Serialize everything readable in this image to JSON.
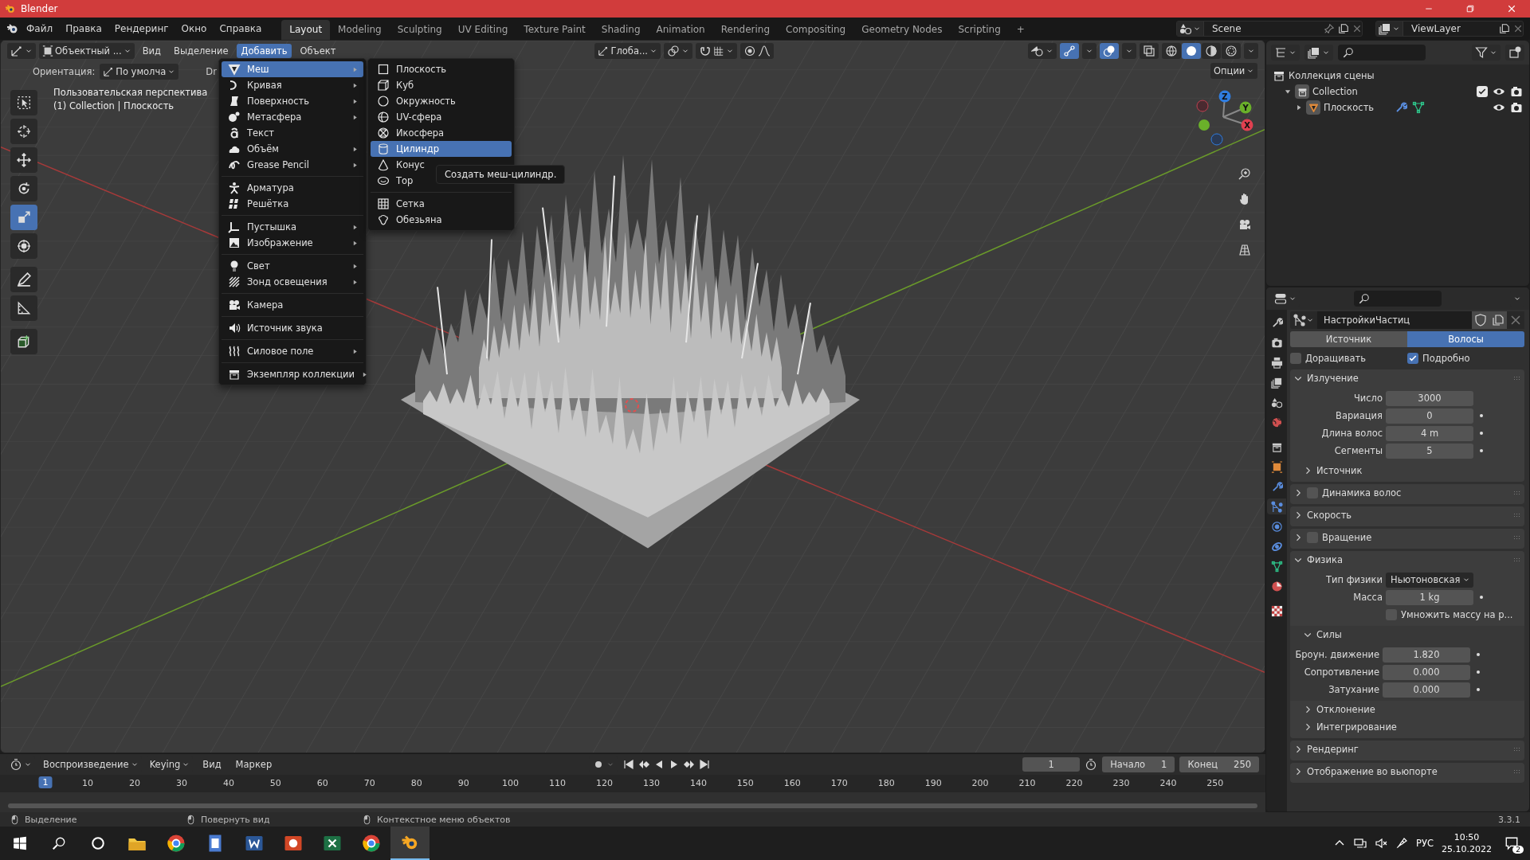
{
  "window": {
    "title": "Blender"
  },
  "menu_bar": [
    "Файл",
    "Правка",
    "Рендеринг",
    "Окно",
    "Справка"
  ],
  "workspace_tabs": [
    {
      "label": "Layout",
      "selected": true
    },
    {
      "label": "Modeling",
      "selected": false
    },
    {
      "label": "Sculpting",
      "selected": false
    },
    {
      "label": "UV Editing",
      "selected": false
    },
    {
      "label": "Texture Paint",
      "selected": false
    },
    {
      "label": "Shading",
      "selected": false
    },
    {
      "label": "Animation",
      "selected": false
    },
    {
      "label": "Rendering",
      "selected": false
    },
    {
      "label": "Compositing",
      "selected": false
    },
    {
      "label": "Geometry Nodes",
      "selected": false
    },
    {
      "label": "Scripting",
      "selected": false
    }
  ],
  "add_workspace": "+",
  "scene": "Scene",
  "view_layer": "ViewLayer",
  "viewport": {
    "mode": "Объектный ...",
    "menus": [
      {
        "label": "Вид",
        "selected": false
      },
      {
        "label": "Выделение",
        "selected": false
      },
      {
        "label": "Добавить",
        "selected": true
      },
      {
        "label": "Объект",
        "selected": false
      }
    ],
    "transform_orientation": "Глоба...",
    "shading_modes": [
      {
        "selected": false
      },
      {
        "selected": true
      },
      {
        "selected": false
      },
      {
        "selected": false
      }
    ],
    "options": "Опции",
    "orientation_label": "Ориентация:",
    "orientation": "По умолча",
    "drag_label": "Dr",
    "overlay_text": [
      "Пользовательская перспектива",
      "(1) Collection | Плоскость"
    ],
    "tools": [
      {
        "selected": false
      },
      {
        "selected": false
      },
      {
        "selected": false
      },
      {
        "selected": false
      },
      {
        "selected": true
      },
      {
        "selected": false
      },
      {
        "selected": false
      },
      {
        "selected": false
      },
      {
        "selected": false
      }
    ],
    "gizmo_axes": [
      "Z",
      "Y",
      "X"
    ]
  },
  "add_menu": {
    "groups": [
      [
        {
          "label": "Меш",
          "submenu": true,
          "selected": true
        },
        {
          "label": "Кривая",
          "submenu": true,
          "selected": false
        },
        {
          "label": "Поверхность",
          "submenu": true,
          "selected": false
        },
        {
          "label": "Метасфера",
          "submenu": true,
          "selected": false
        },
        {
          "label": "Текст",
          "submenu": false,
          "selected": false
        },
        {
          "label": "Объём",
          "submenu": true,
          "selected": false
        },
        {
          "label": "Grease Pencil",
          "submenu": true,
          "selected": false
        }
      ],
      [
        {
          "label": "Арматура",
          "submenu": false,
          "selected": false
        },
        {
          "label": "Решётка",
          "submenu": false,
          "selected": false
        }
      ],
      [
        {
          "label": "Пустышка",
          "submenu": true,
          "selected": false
        },
        {
          "label": "Изображение",
          "submenu": true,
          "selected": false
        }
      ],
      [
        {
          "label": "Свет",
          "submenu": true,
          "selected": false
        },
        {
          "label": "Зонд освещения",
          "submenu": true,
          "selected": false
        }
      ],
      [
        {
          "label": "Камера",
          "submenu": false,
          "selected": false
        }
      ],
      [
        {
          "label": "Источник звука",
          "submenu": false,
          "selected": false
        }
      ],
      [
        {
          "label": "Силовое поле",
          "submenu": true,
          "selected": false
        }
      ],
      [
        {
          "label": "Экземпляр коллекции",
          "submenu": true,
          "selected": false
        }
      ]
    ]
  },
  "mesh_menu": {
    "groups": [
      [
        {
          "label": "Плоскость",
          "selected": false
        },
        {
          "label": "Куб",
          "selected": false
        },
        {
          "label": "Окружность",
          "selected": false
        },
        {
          "label": "UV-сфера",
          "selected": false
        },
        {
          "label": "Икосфера",
          "selected": false
        },
        {
          "label": "Цилиндр",
          "selected": true
        },
        {
          "label": "Конус",
          "selected": false
        },
        {
          "label": "Тор",
          "selected": false
        }
      ],
      [
        {
          "label": "Сетка",
          "selected": false
        },
        {
          "label": "Обезьяна",
          "selected": false
        }
      ]
    ]
  },
  "tooltip": "Создать меш-цилиндр.",
  "outliner": {
    "root": {
      "label": "Коллекция сцены",
      "children": [
        {
          "label": "Collection",
          "expanded": true,
          "checked": true,
          "children": [
            {
              "label": "Плоскость",
              "expanded": false
            }
          ]
        }
      ]
    }
  },
  "properties": {
    "tabs": [
      {
        "selected": false
      },
      {
        "selected": false
      },
      {
        "selected": false
      },
      {
        "selected": false
      },
      {
        "selected": false
      },
      {
        "selected": false
      },
      {
        "selected": false
      },
      {
        "selected": false
      },
      {
        "selected": false
      },
      {
        "selected": true
      },
      {
        "selected": false
      },
      {
        "selected": false
      },
      {
        "selected": false
      },
      {
        "selected": false
      },
      {
        "selected": false
      }
    ],
    "datablock": "НастройкиЧастиц",
    "type_tabs": [
      {
        "label": "Источник",
        "selected": false
      },
      {
        "label": "Волосы",
        "selected": true
      }
    ],
    "options": [
      {
        "label": "Доращивать",
        "checked": false
      },
      {
        "label": "Подробно",
        "checked": true
      }
    ],
    "panels": [
      {
        "title": "Излучение",
        "expanded": true,
        "rows": [
          {
            "kind": "number",
            "label": "Число",
            "value": "3000",
            "keyframe_dot": false
          },
          {
            "kind": "number",
            "label": "Вариация",
            "value": "0",
            "keyframe_dot": true
          },
          {
            "kind": "number",
            "label": "Длина волос",
            "value": "4 m",
            "keyframe_dot": true
          },
          {
            "kind": "number",
            "label": "Сегменты",
            "value": "5",
            "keyframe_dot": true
          }
        ],
        "subpanels": [
          {
            "title": "Источник",
            "expanded": false
          }
        ]
      },
      {
        "title": "Динамика волос",
        "expanded": false,
        "checked": false
      },
      {
        "title": "Скорость",
        "expanded": false
      },
      {
        "title": "Вращение",
        "expanded": false,
        "checked": false
      },
      {
        "title": "Физика",
        "expanded": true,
        "rows": [
          {
            "kind": "dropdown",
            "label": "Тип физики",
            "value": "Ньютоновская"
          },
          {
            "kind": "number",
            "label": "Масса",
            "value": "1 kg",
            "keyframe_dot": true
          },
          {
            "kind": "checkbox",
            "label": "Умножить массу на р...",
            "checked": false
          }
        ],
        "subpanels": [
          {
            "title": "Силы",
            "expanded": true,
            "rows": [
              {
                "kind": "number",
                "label": "Броун. движение",
                "value": "1.820",
                "keyframe_dot": true
              },
              {
                "kind": "number",
                "label": "Сопротивление",
                "value": "0.000",
                "keyframe_dot": true
              },
              {
                "kind": "number",
                "label": "Затухание",
                "value": "0.000",
                "keyframe_dot": true
              }
            ]
          },
          {
            "title": "Отклонение",
            "expanded": false
          },
          {
            "title": "Интегрирование",
            "expanded": false
          }
        ]
      },
      {
        "title": "Рендеринг",
        "expanded": false
      },
      {
        "title": "Отображение во вьюпорте",
        "expanded": false
      }
    ]
  },
  "timeline": {
    "menus": [
      {
        "label": "Воспроизведение",
        "dropdown": true
      },
      {
        "label": "Keying",
        "dropdown": true
      },
      {
        "label": "Вид",
        "dropdown": false
      },
      {
        "label": "Маркер",
        "dropdown": false
      }
    ],
    "current_frame": "1",
    "start_label": "Начало",
    "start": "1",
    "end_label": "Конец",
    "end": "250",
    "playhead": "1",
    "frames": [
      "10",
      "20",
      "30",
      "40",
      "50",
      "60",
      "70",
      "80",
      "90",
      "100",
      "110",
      "120",
      "130",
      "140",
      "150",
      "160",
      "170",
      "180",
      "190",
      "200",
      "210",
      "220",
      "230",
      "240",
      "250"
    ]
  },
  "status_bar": {
    "hints": [
      "Выделение",
      "Повернуть вид",
      "Контекстное меню объектов"
    ],
    "version": "3.3.1"
  },
  "taskbar": {
    "language": "РУС",
    "time": "10:50",
    "date": "25.10.2022",
    "notifications": "2"
  }
}
